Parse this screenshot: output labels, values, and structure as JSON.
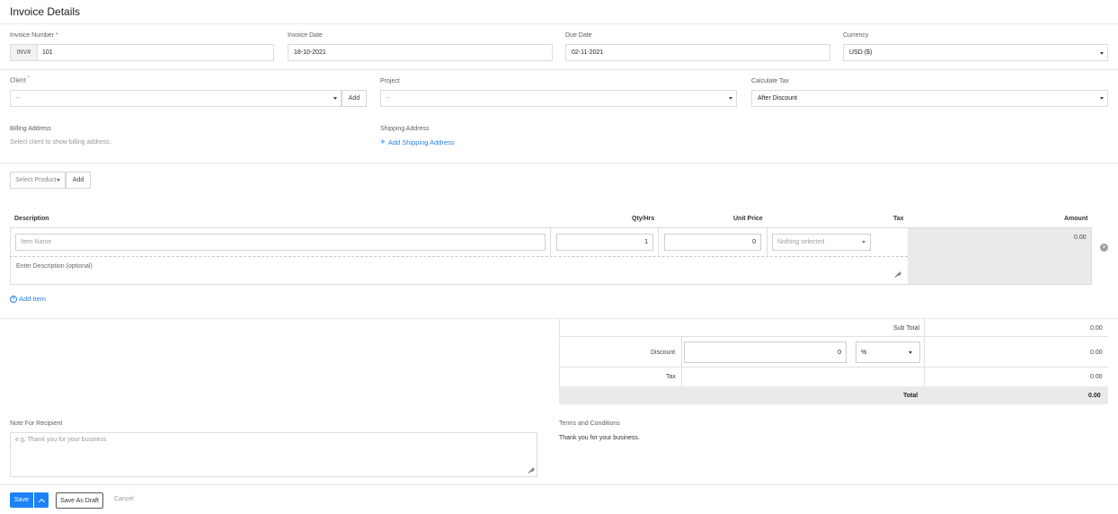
{
  "page": {
    "title": "Invoice Details"
  },
  "row1": {
    "invoice_number": {
      "label": "Invoice Number",
      "required": "*",
      "prefix": "INV#",
      "value": "101"
    },
    "invoice_date": {
      "label": "Invoice Date",
      "value": "18-10-2021"
    },
    "due_date": {
      "label": "Due Date",
      "value": "02-11-2021"
    },
    "currency": {
      "label": "Currency",
      "value": "USD ($)"
    }
  },
  "row2": {
    "client": {
      "label": "Client",
      "required": "*",
      "value": "--",
      "add_label": "Add"
    },
    "project": {
      "label": "Project",
      "value": "--"
    },
    "calculate_tax": {
      "label": "Calculate Tax",
      "value": "After Discount"
    }
  },
  "addresses": {
    "billing": {
      "label": "Billing Address",
      "hint": "Select client to show billing address."
    },
    "shipping": {
      "label": "Shipping Address",
      "add_label": "Add Shipping Address"
    }
  },
  "product": {
    "select_label": "Select Product",
    "add_label": "Add"
  },
  "items_table": {
    "headers": {
      "description": "Description",
      "qty": "Qty/Hrs",
      "unit_price": "Unit Price",
      "tax": "Tax",
      "amount": "Amount"
    },
    "row": {
      "item_name_placeholder": "Item Name",
      "qty": "1",
      "unit_price": "0",
      "tax_placeholder": "Nothing selected",
      "amount": "0.00",
      "description_placeholder": "Enter Description (optional)"
    },
    "add_item_label": "Add Item"
  },
  "totals": {
    "sub_total_label": "Sub Total",
    "sub_total": "0.00",
    "discount_label": "Discount",
    "discount_value": "0",
    "discount_type": "%",
    "discount_amount": "0.00",
    "tax_label": "Tax",
    "tax_amount": "0.00",
    "total_label": "Total",
    "total": "0.00"
  },
  "notes": {
    "recipient_label": "Note For Recipient",
    "recipient_placeholder": "e.g. Thank you for your business",
    "terms_label": "Terms and Conditions",
    "terms_text": "Thank you for your business."
  },
  "actions": {
    "save": "Save",
    "save_draft": "Save As Draft",
    "cancel": "Cancel"
  },
  "colors": {
    "accent": "#1d82f5",
    "danger": "#d9534f",
    "grey_panel": "#e9eaec"
  }
}
